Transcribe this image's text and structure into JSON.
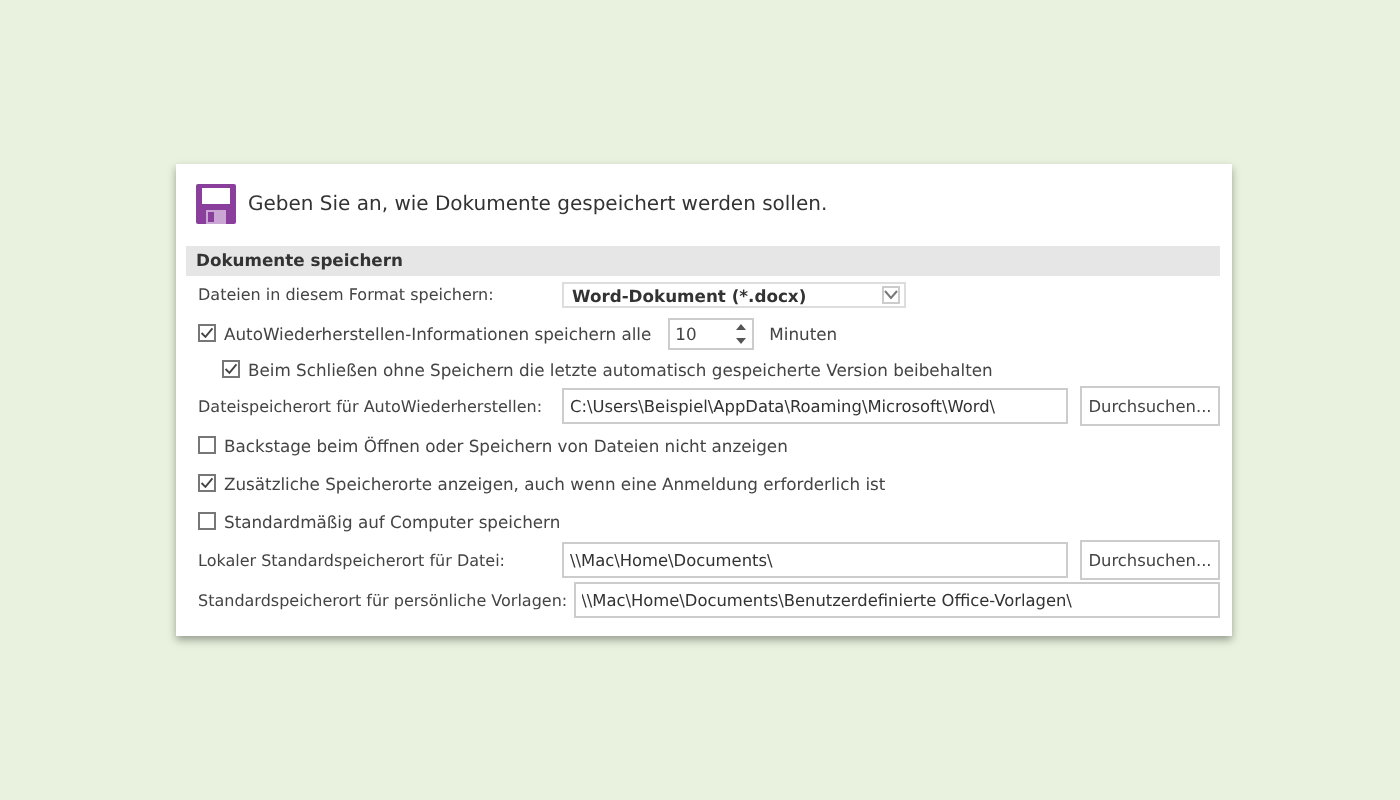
{
  "header": {
    "text": "Geben Sie an, wie Dokumente gespeichert werden sollen."
  },
  "section": {
    "title": "Dokumente speichern"
  },
  "rows": [
    {
      "kind": "select",
      "label": "Dateien in diesem Format speichern:",
      "value": "Word-Dokument (*.docx)"
    },
    {
      "kind": "spin",
      "label": "AutoWiederherstellen-Informationen speichern alle",
      "checked": true,
      "value": "10",
      "unit": "Minuten"
    },
    {
      "kind": "subcheck",
      "label": "Beim Schließen ohne Speichern die letzte automatisch gespeicherte Version beibehalten",
      "checked": true
    },
    {
      "kind": "path",
      "label": "Dateispeicherort für AutoWiederherstellen:",
      "value": "C:\\Users\\Beispiel\\AppData\\Roaming\\Microsoft\\Word\\",
      "button": "Durchsuchen..."
    },
    {
      "kind": "check",
      "label": "Backstage beim Öffnen oder Speichern von Dateien nicht anzeigen",
      "checked": false
    },
    {
      "kind": "check",
      "label": "Zusätzliche Speicherorte anzeigen, auch wenn eine Anmeldung erforderlich ist",
      "checked": true
    },
    {
      "kind": "check",
      "label": "Standardmäßig auf Computer speichern",
      "checked": false
    },
    {
      "kind": "path",
      "label": "Lokaler Standardspeicherort für Datei:",
      "value": "\\\\Mac\\Home\\Documents\\",
      "button": "Durchsuchen..."
    },
    {
      "kind": "path",
      "label": "Standardspeicherort für persönliche Vorlagen:",
      "value": "\\\\Mac\\Home\\Documents\\Benutzerdefinierte Office-Vorlagen\\"
    }
  ]
}
